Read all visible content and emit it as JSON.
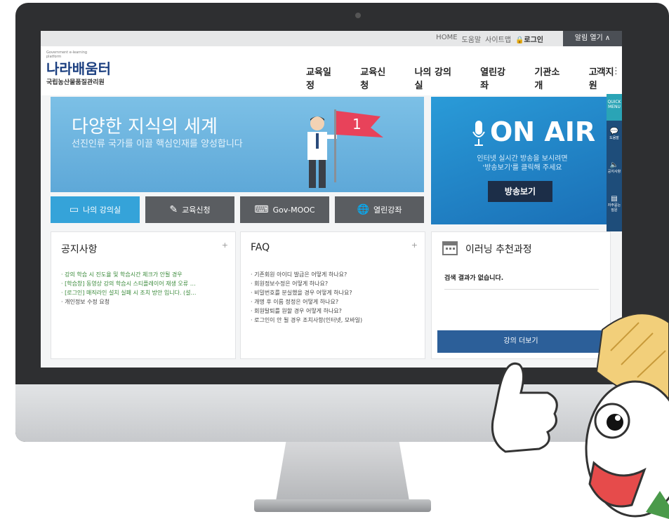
{
  "utility_nav": {
    "home": "HOME",
    "help": "도움말",
    "sitemap": "사이트맵",
    "login": "로그인",
    "alarm": "알림 열기"
  },
  "logo": {
    "small": "Government e-learning platform",
    "name": "나라배움터",
    "org": "국립농산물품질관리원"
  },
  "gnb": [
    "교육일정",
    "교육신청",
    "나의 강의실",
    "열린강좌",
    "기관소개",
    "고객지원"
  ],
  "banner": {
    "title": "다양한 지식의 세계",
    "subtitle": "선진인류 국가를 이끌 핵심인재를 양성합니다",
    "flag_number": "1"
  },
  "onair": {
    "title": "ON AIR",
    "desc1": "인터넷 실시간 방송을 보시려면",
    "desc2": "'방송보기'를 클릭해 주세요",
    "button": "방송보기"
  },
  "quick_menu": {
    "title": "QUICK MENU",
    "items": [
      {
        "label": "도움말",
        "icon": "chat-icon"
      },
      {
        "label": "공지사항",
        "icon": "speaker-icon"
      },
      {
        "label": "자주묻는 질문",
        "icon": "faq-icon"
      }
    ]
  },
  "tabs": [
    {
      "label": "나의 강의실",
      "icon": "monitor-icon",
      "active": true
    },
    {
      "label": "교육신청",
      "icon": "edit-icon",
      "active": false
    },
    {
      "label": "Gov-MOOC",
      "icon": "laptop-icon",
      "active": false
    },
    {
      "label": "열린강좌",
      "icon": "globe-icon",
      "active": false
    }
  ],
  "notice": {
    "title": "공지사항",
    "items": [
      {
        "text": "강의 학습 시 진도율 및 학습시간 체크가 안될 경우",
        "green": true
      },
      {
        "text": "[학습창] 동영상 강의 학습시 스티플레이어 재생 오류 …",
        "green": true
      },
      {
        "text": "[로그인] 매직라인 설치 실패 시 조치 방안 입니다. (설…",
        "green": true
      },
      {
        "text": "개인정보 수정 요청",
        "green": false
      }
    ]
  },
  "faq": {
    "title": "FAQ",
    "items": [
      "기존회원 아이디 발급은 어떻게 하나요?",
      "회원정보수정은 어떻게 하나요?",
      "비밀번호를 분실했을 경우 어떻게 하나요?",
      "개명 후 이름 정정은 어떻게 하나요?",
      "회원탈퇴를 원할 경우 어떻게 하나요?",
      "로그인이 안 될 경우 조치사항(인터넷, 모바일)"
    ]
  },
  "recommend": {
    "title": "이러닝 추천과정",
    "empty": "검색 결과가 없습니다.",
    "button": "강의 더보기"
  },
  "colors": {
    "accent": "#35a3d9",
    "navy": "#1c2e48",
    "tab_dark": "#5a5d61",
    "quick": "#1e4d7a"
  }
}
